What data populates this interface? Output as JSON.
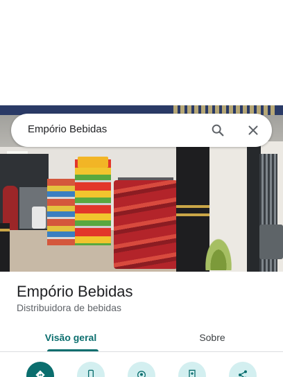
{
  "search": {
    "query": "Empório Bebidas",
    "search_icon": "search-icon",
    "close_icon": "close-icon"
  },
  "place": {
    "name": "Empório Bebidas",
    "category": "Distribuidora de bebidas"
  },
  "tabs": [
    {
      "label": "Visão geral",
      "active": true
    },
    {
      "label": "Sobre",
      "active": false
    }
  ],
  "actions": [
    {
      "icon": "directions-icon"
    },
    {
      "icon": "phone-icon"
    },
    {
      "icon": "location-icon"
    },
    {
      "icon": "save-icon"
    },
    {
      "icon": "share-icon"
    }
  ],
  "colors": {
    "accent": "#0b6e6e",
    "accent_light": "#d3eff0",
    "text_primary": "#202124",
    "text_secondary": "#5f6368"
  }
}
